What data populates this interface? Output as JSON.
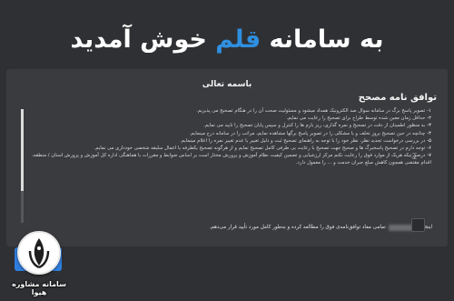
{
  "header": {
    "title_before": "به سامانه",
    "title_accent": "قلم",
    "title_after": "خوش آمدید"
  },
  "panel": {
    "bismillah": "باسمه تعالی",
    "agreement_title": "توافق نامه مصحح",
    "rules": [
      {
        "num": "۱-",
        "text": "تصویر پاسخ برگ در سامانه سوال صد الکترونیک همداد میشود و مسئولیت صحت آن را در هنگام تصحیح می پذیریم."
      },
      {
        "num": "۲-",
        "text": "حداقل زمان معین شده توسط طراح برای تصحیح را رعایت می نمایم."
      },
      {
        "num": "۳-",
        "text": "به منظور اطمینان از دقت در تصحیح و نمره گذاری، ریز بارم ها را کنترل و سپس پایان تصحیح را تایید می نمایم."
      },
      {
        "num": "۴-",
        "text": "چنانچه در حین تصحیح بروز تخلف و یا مشکلی را در تصویر پاسخ برگها مشاهده نمایم، مراتب را در سامانه درج مینمایم."
      },
      {
        "num": "۵-",
        "text": "در بررسی درخواست تجدید نظر، نظر خود را با توجه به راهنمای تصحیح ثبت و دلیل تغییر یا عدم تغییر نمره را اعلام مینمایم."
      },
      {
        "num": "۶-",
        "text": "توجه دارم در تصحیح پاسخبرگ ها و صحیح جهت تصحیح با رعایت بی طرفی کامل تصحیح نمایم و از هرگونه تصحیح یکطرفه یا اعمال سلیقه شخصی خودداری می نمایم."
      },
      {
        "num": "۷-",
        "text": "درصورتیکه هریک از موارد فوق را رعایت نکنم مرکز ارزشیابی و تضمین کیفیت نظام آموزش و پرورش مختار است بر اساس ضوابط و مقررات با هماهنگی اداره کل آموزش و پرورش استان / منطقه، اقدام مقتضی همچون کاهش مبلغ جبران خدمت و ... را معمول دارد."
      }
    ],
    "cursor_glyph": "⌶"
  },
  "confirm": {
    "label_prefix": "اینجانب",
    "label_suffix": "تمامی مفاد توافق‌نامه‌ی فوق را مطالعه کرده و به‌طور کامل مورد تأیید قرار می‌دهم."
  },
  "logo": {
    "name": "سامانه مشاوره هیوا",
    "sub": ""
  },
  "colors": {
    "accent": "#2f8fe0",
    "background": "#2f3033",
    "panel": "#3a3b3e"
  }
}
